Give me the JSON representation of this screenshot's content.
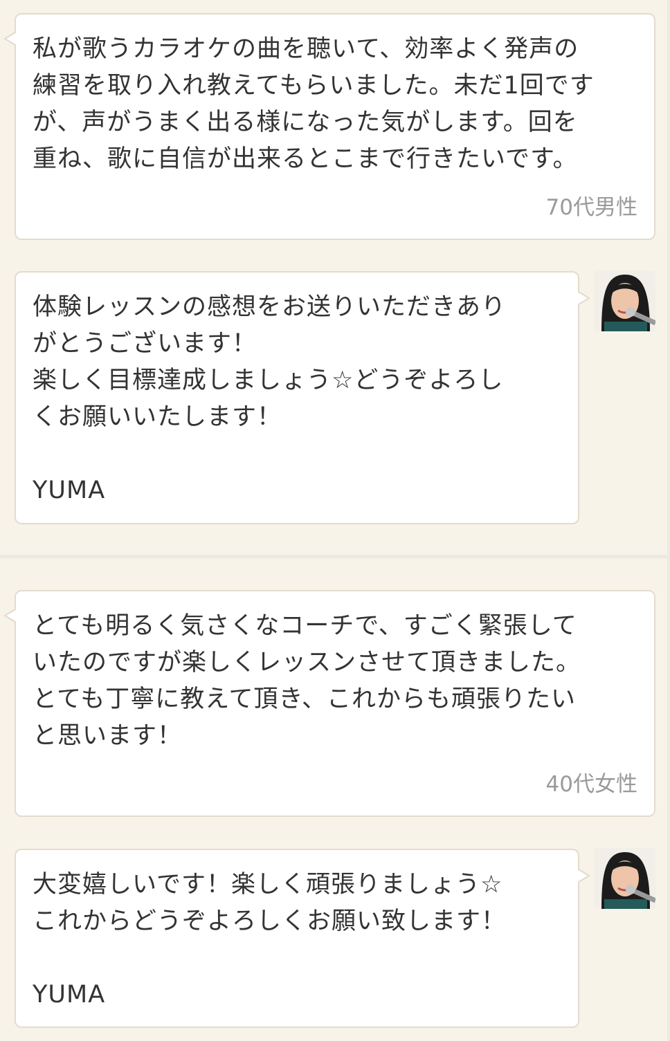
{
  "threads": [
    {
      "review": {
        "text": "私が歌うカラオケの曲を聴いて、効率よく発声の\n練習を取り入れ教えてもらいました。未だ1回です\nが、声がうまく出る様になった気がします。回を\n重ね、歌に自信が出来るとこまで行きたいです。",
        "author_label": "70代男性"
      },
      "reply": {
        "text": "体験レッスンの感想をお送りいただきあり\nがとうございます！\n楽しく目標達成しましょう☆どうぞよろし\nくお願いいたします！\n\nYUMA"
      }
    },
    {
      "review": {
        "text": "とても明るく気さくなコーチで、すごく緊張して\nいたのですが楽しくレッスンさせて頂きました。\nとても丁寧に教えて頂き、これからも頑張りたい\nと思います！",
        "author_label": "40代女性"
      },
      "reply": {
        "text": "大変嬉しいです！楽しく頑張りましょう☆\nこれからどうぞよろしくお願い致します！\n\nYUMA"
      }
    }
  ],
  "colors": {
    "background": "#f8f3e8",
    "bubble": "#ffffff",
    "bubble_border": "#e3dccd",
    "text": "#333333",
    "meta": "#9a9a9a"
  },
  "icons": {
    "coach_avatar": "coach-avatar-photo"
  }
}
